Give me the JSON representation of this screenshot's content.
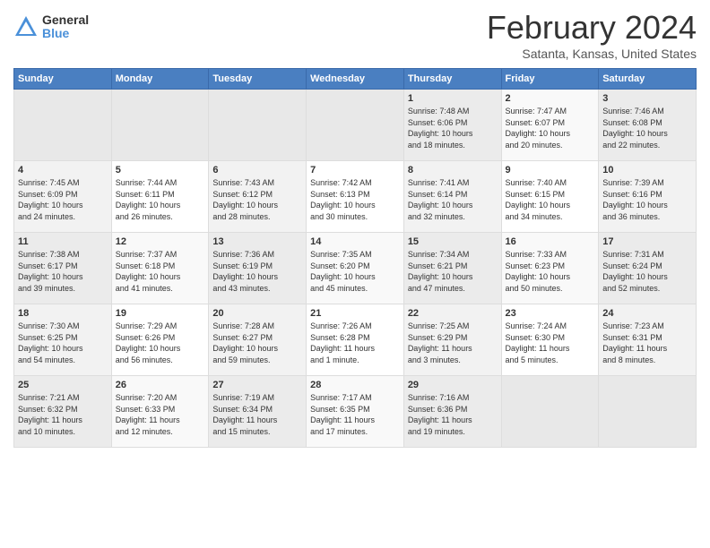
{
  "logo": {
    "general": "General",
    "blue": "Blue"
  },
  "title": "February 2024",
  "location": "Satanta, Kansas, United States",
  "days_of_week": [
    "Sunday",
    "Monday",
    "Tuesday",
    "Wednesday",
    "Thursday",
    "Friday",
    "Saturday"
  ],
  "weeks": [
    [
      {
        "day": "",
        "content": ""
      },
      {
        "day": "",
        "content": ""
      },
      {
        "day": "",
        "content": ""
      },
      {
        "day": "",
        "content": ""
      },
      {
        "day": "1",
        "content": "Sunrise: 7:48 AM\nSunset: 6:06 PM\nDaylight: 10 hours\nand 18 minutes."
      },
      {
        "day": "2",
        "content": "Sunrise: 7:47 AM\nSunset: 6:07 PM\nDaylight: 10 hours\nand 20 minutes."
      },
      {
        "day": "3",
        "content": "Sunrise: 7:46 AM\nSunset: 6:08 PM\nDaylight: 10 hours\nand 22 minutes."
      }
    ],
    [
      {
        "day": "4",
        "content": "Sunrise: 7:45 AM\nSunset: 6:09 PM\nDaylight: 10 hours\nand 24 minutes."
      },
      {
        "day": "5",
        "content": "Sunrise: 7:44 AM\nSunset: 6:11 PM\nDaylight: 10 hours\nand 26 minutes."
      },
      {
        "day": "6",
        "content": "Sunrise: 7:43 AM\nSunset: 6:12 PM\nDaylight: 10 hours\nand 28 minutes."
      },
      {
        "day": "7",
        "content": "Sunrise: 7:42 AM\nSunset: 6:13 PM\nDaylight: 10 hours\nand 30 minutes."
      },
      {
        "day": "8",
        "content": "Sunrise: 7:41 AM\nSunset: 6:14 PM\nDaylight: 10 hours\nand 32 minutes."
      },
      {
        "day": "9",
        "content": "Sunrise: 7:40 AM\nSunset: 6:15 PM\nDaylight: 10 hours\nand 34 minutes."
      },
      {
        "day": "10",
        "content": "Sunrise: 7:39 AM\nSunset: 6:16 PM\nDaylight: 10 hours\nand 36 minutes."
      }
    ],
    [
      {
        "day": "11",
        "content": "Sunrise: 7:38 AM\nSunset: 6:17 PM\nDaylight: 10 hours\nand 39 minutes."
      },
      {
        "day": "12",
        "content": "Sunrise: 7:37 AM\nSunset: 6:18 PM\nDaylight: 10 hours\nand 41 minutes."
      },
      {
        "day": "13",
        "content": "Sunrise: 7:36 AM\nSunset: 6:19 PM\nDaylight: 10 hours\nand 43 minutes."
      },
      {
        "day": "14",
        "content": "Sunrise: 7:35 AM\nSunset: 6:20 PM\nDaylight: 10 hours\nand 45 minutes."
      },
      {
        "day": "15",
        "content": "Sunrise: 7:34 AM\nSunset: 6:21 PM\nDaylight: 10 hours\nand 47 minutes."
      },
      {
        "day": "16",
        "content": "Sunrise: 7:33 AM\nSunset: 6:23 PM\nDaylight: 10 hours\nand 50 minutes."
      },
      {
        "day": "17",
        "content": "Sunrise: 7:31 AM\nSunset: 6:24 PM\nDaylight: 10 hours\nand 52 minutes."
      }
    ],
    [
      {
        "day": "18",
        "content": "Sunrise: 7:30 AM\nSunset: 6:25 PM\nDaylight: 10 hours\nand 54 minutes."
      },
      {
        "day": "19",
        "content": "Sunrise: 7:29 AM\nSunset: 6:26 PM\nDaylight: 10 hours\nand 56 minutes."
      },
      {
        "day": "20",
        "content": "Sunrise: 7:28 AM\nSunset: 6:27 PM\nDaylight: 10 hours\nand 59 minutes."
      },
      {
        "day": "21",
        "content": "Sunrise: 7:26 AM\nSunset: 6:28 PM\nDaylight: 11 hours\nand 1 minute."
      },
      {
        "day": "22",
        "content": "Sunrise: 7:25 AM\nSunset: 6:29 PM\nDaylight: 11 hours\nand 3 minutes."
      },
      {
        "day": "23",
        "content": "Sunrise: 7:24 AM\nSunset: 6:30 PM\nDaylight: 11 hours\nand 5 minutes."
      },
      {
        "day": "24",
        "content": "Sunrise: 7:23 AM\nSunset: 6:31 PM\nDaylight: 11 hours\nand 8 minutes."
      }
    ],
    [
      {
        "day": "25",
        "content": "Sunrise: 7:21 AM\nSunset: 6:32 PM\nDaylight: 11 hours\nand 10 minutes."
      },
      {
        "day": "26",
        "content": "Sunrise: 7:20 AM\nSunset: 6:33 PM\nDaylight: 11 hours\nand 12 minutes."
      },
      {
        "day": "27",
        "content": "Sunrise: 7:19 AM\nSunset: 6:34 PM\nDaylight: 11 hours\nand 15 minutes."
      },
      {
        "day": "28",
        "content": "Sunrise: 7:17 AM\nSunset: 6:35 PM\nDaylight: 11 hours\nand 17 minutes."
      },
      {
        "day": "29",
        "content": "Sunrise: 7:16 AM\nSunset: 6:36 PM\nDaylight: 11 hours\nand 19 minutes."
      },
      {
        "day": "",
        "content": ""
      },
      {
        "day": "",
        "content": ""
      }
    ]
  ]
}
